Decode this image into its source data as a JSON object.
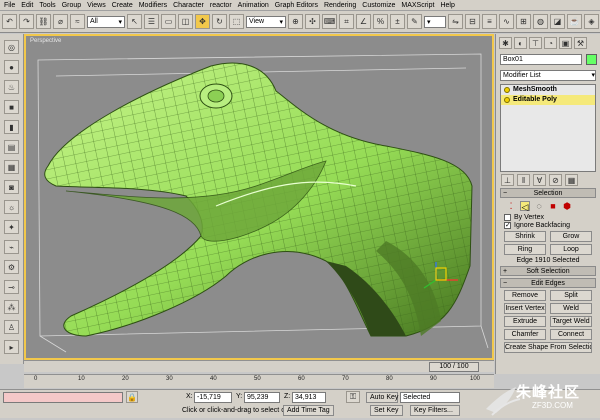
{
  "menu": [
    "File",
    "Edit",
    "Tools",
    "Group",
    "Views",
    "Create",
    "Modifiers",
    "Character",
    "reactor",
    "Animation",
    "Graph Editors",
    "Rendering",
    "Customize",
    "MAXScript",
    "Help"
  ],
  "toolbar": {
    "filter_value": "All",
    "refcoord_value": "View"
  },
  "viewport": {
    "label": "Perspective",
    "border_color": "#f2c84b",
    "mesh_color": "#a6e86a"
  },
  "panel": {
    "object_name": "Box01",
    "object_color": "#66ff66",
    "modifier_list_label": "Modifier List",
    "stack": [
      "MeshSmooth",
      "Editable Poly"
    ],
    "selection": {
      "title": "Selection",
      "by_vertex": "By Vertex",
      "ignore_backfacing": "Ignore Backfacing",
      "shrink": "Shrink",
      "grow": "Grow",
      "ring": "Ring",
      "loop": "Loop",
      "info": "Edge 1910 Selected"
    },
    "soft_selection_title": "Soft Selection",
    "edit_edges": {
      "title": "Edit Edges",
      "remove": "Remove",
      "split": "Split",
      "insert_vertex": "Insert Vertex",
      "weld": "Weld",
      "extrude": "Extrude",
      "target_weld": "Target Weld",
      "chamfer": "Chamfer",
      "connect": "Connect",
      "create_shape": "Create Shape From Selection"
    }
  },
  "timeline": {
    "slider": "100 / 100",
    "ticks": [
      "0",
      "10",
      "20",
      "30",
      "40",
      "50",
      "60",
      "70",
      "80",
      "90",
      "100"
    ]
  },
  "status": {
    "x_label": "X:",
    "x_value": "-15,719",
    "y_label": "Y:",
    "y_value": "95,239",
    "z_label": "Z:",
    "z_value": "34,913",
    "prompt": "Click or click-and-drag to select obj",
    "add_time_tag": "Add Time Tag",
    "auto_key": "Auto Key",
    "set_key": "Set Key",
    "selected_value": "Selected",
    "key_filters": "Key Filters..."
  },
  "watermark": {
    "text": "朱峰社区",
    "sub": "ZF3D.COM"
  }
}
